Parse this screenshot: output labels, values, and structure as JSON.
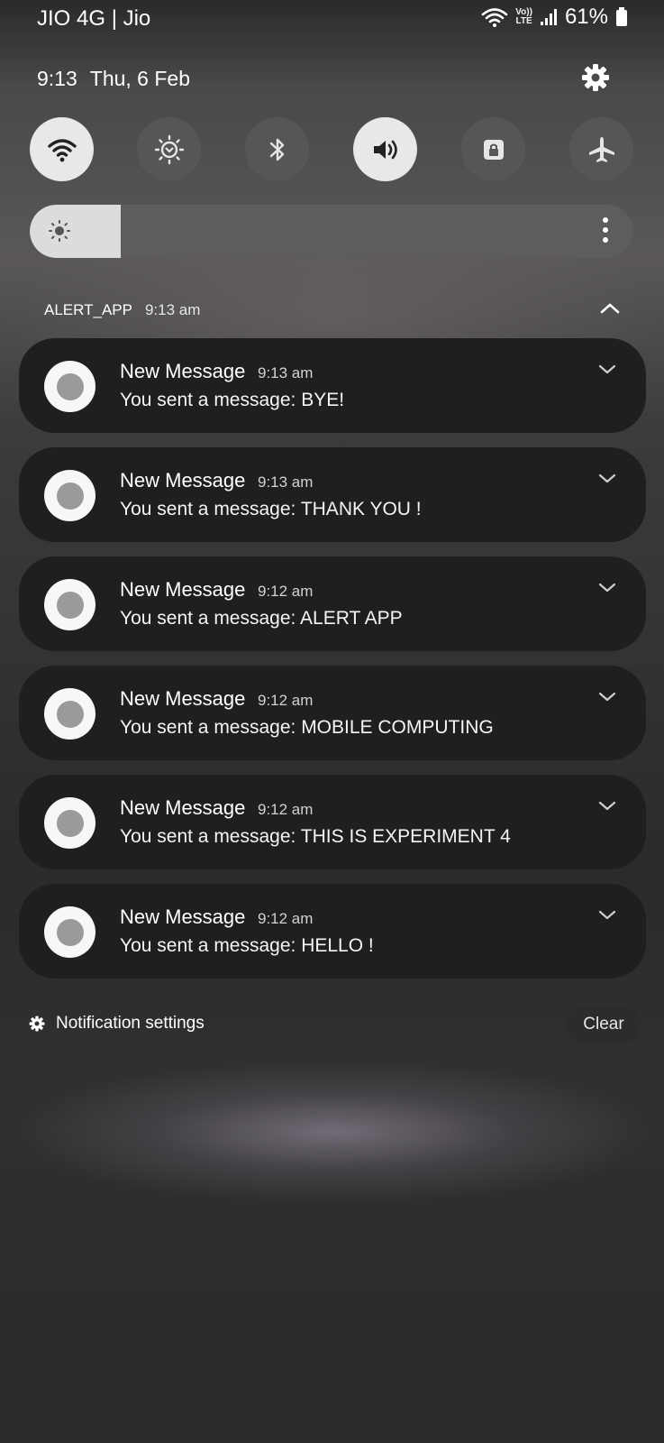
{
  "status_bar": {
    "carrier": "JIO 4G | Jio",
    "battery": "61%",
    "volte_top": "Vo))",
    "volte_bottom": "LTE"
  },
  "header": {
    "time": "9:13",
    "date": "Thu, 6 Feb"
  },
  "quick_tiles": [
    {
      "icon": "wifi-icon",
      "state": "on"
    },
    {
      "icon": "eye-comfort-icon",
      "state": "off"
    },
    {
      "icon": "bluetooth-icon",
      "state": "off"
    },
    {
      "icon": "sound-icon",
      "state": "on"
    },
    {
      "icon": "rotation-lock-icon",
      "state": "off"
    },
    {
      "icon": "airplane-icon",
      "state": "off"
    }
  ],
  "brightness": {
    "level": 0.15
  },
  "notification_group": {
    "app": "ALERT_APP",
    "time": "9:13 am"
  },
  "notifications": [
    {
      "title": "New Message",
      "time": "9:13 am",
      "body": "You sent a message: BYE!"
    },
    {
      "title": "New Message",
      "time": "9:13 am",
      "body": "You sent a message: THANK YOU !"
    },
    {
      "title": "New Message",
      "time": "9:12 am",
      "body": "You sent a message: ALERT APP"
    },
    {
      "title": "New Message",
      "time": "9:12 am",
      "body": "You sent a message: MOBILE COMPUTING"
    },
    {
      "title": "New Message",
      "time": "9:12 am",
      "body": "You sent a message: THIS IS EXPERIMENT 4"
    },
    {
      "title": "New Message",
      "time": "9:12 am",
      "body": "You sent a message: HELLO !"
    }
  ],
  "footer": {
    "settings_label": "Notification settings",
    "clear_label": "Clear"
  }
}
